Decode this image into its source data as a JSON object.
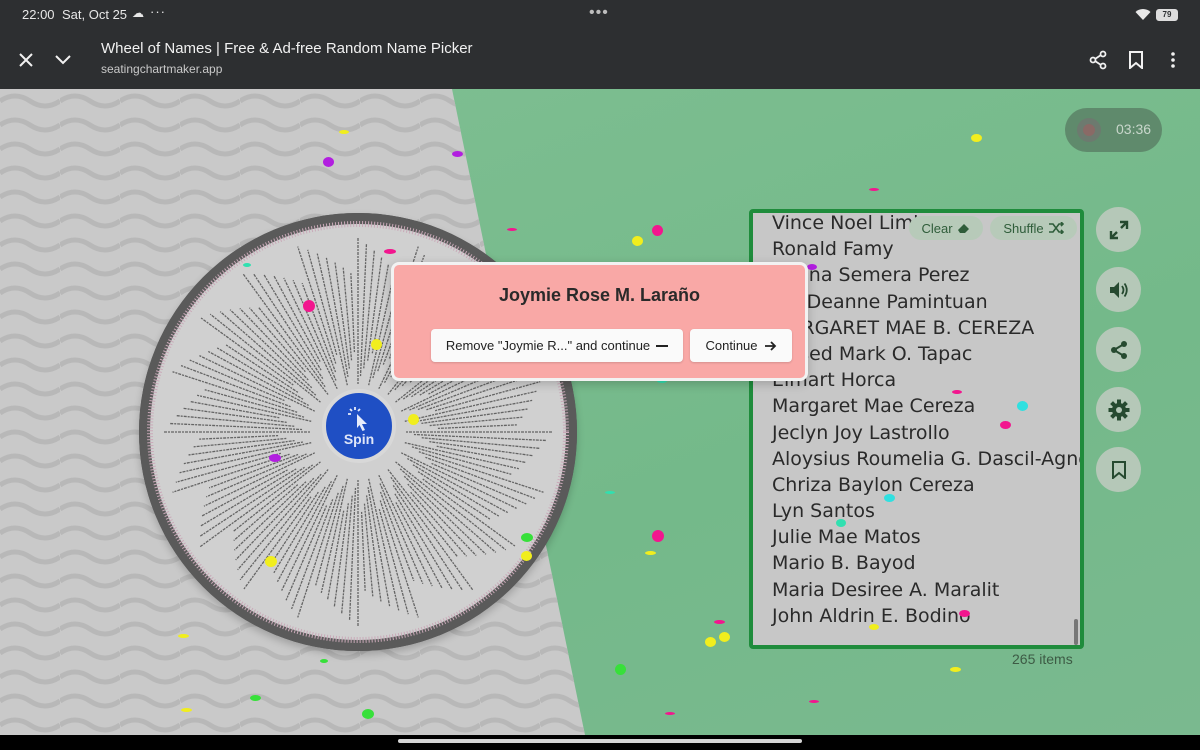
{
  "status_bar": {
    "time": "22:00",
    "date": "Sat, Oct 25",
    "battery": "79"
  },
  "browser": {
    "title": "Wheel of Names | Free & Ad-free Random Name Picker",
    "url": "seatingchartmaker.app"
  },
  "timer": {
    "time": "03:36"
  },
  "wheel": {
    "spin_label": "Spin"
  },
  "names_panel": {
    "clear_label": "Clear",
    "shuffle_label": "Shuffle",
    "names": [
      "Vince Noel Limbo",
      "Ronald Famy",
      "Sarina Semera Perez",
      "Iris Deanne Pamintuan",
      "MARGARET MAE B. CEREZA",
      "Jessed Mark O. Tapac",
      "Elmart Horca",
      "Margaret Mae Cereza",
      "Jeclyn Joy Lastrollo",
      "Aloysius Roumelia G. Dascil-Agno",
      "Chriza Baylon Cereza",
      "Lyn Santos",
      "Julie Mae Matos",
      "Mario B. Bayod",
      "Maria Desiree A. Maralit",
      "John Aldrin E. Bodino"
    ],
    "item_count": "265 items"
  },
  "modal": {
    "winner": "Joymie Rose M. Laraño",
    "remove_label": "Remove \"Joymie R...\" and continue",
    "continue_label": "Continue"
  },
  "colors": {
    "accent_green": "#1f8c3c",
    "spin_blue": "#1f4fc4",
    "modal_bg": "#f9a8a6"
  }
}
